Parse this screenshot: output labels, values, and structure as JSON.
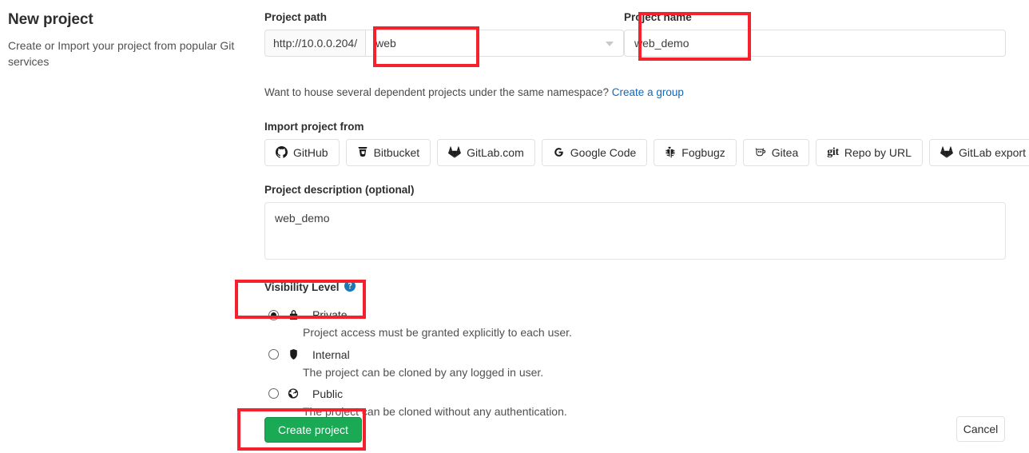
{
  "intro": {
    "title": "New project",
    "description": "Create or Import your project from popular Git services"
  },
  "form": {
    "project_path": {
      "label": "Project path",
      "prefix": "http://10.0.0.204/",
      "namespace_value": "web",
      "caret_icon": "chevron-down-icon"
    },
    "project_name": {
      "label": "Project name",
      "value": "web_demo",
      "placeholder": ""
    },
    "namespace_hint": {
      "text": "Want to house several dependent projects under the same namespace?",
      "link_label": "Create a group",
      "link_color": "#1068bf"
    },
    "import": {
      "label": "Import project from",
      "buttons": [
        {
          "label": "GitHub",
          "icon": "github-icon"
        },
        {
          "label": "Bitbucket",
          "icon": "bitbucket-icon"
        },
        {
          "label": "GitLab.com",
          "icon": "gitlab-icon"
        },
        {
          "label": "Google Code",
          "icon": "google-icon"
        },
        {
          "label": "Fogbugz",
          "icon": "bug-icon"
        },
        {
          "label": "Gitea",
          "icon": "gitea-icon"
        },
        {
          "label": "Repo by URL",
          "icon": "git-icon"
        },
        {
          "label": "GitLab export",
          "icon": "gitlab-icon"
        }
      ]
    },
    "description_field": {
      "label": "Project description (optional)",
      "value": "web_demo",
      "placeholder": ""
    },
    "visibility": {
      "label": "Visibility Level",
      "help_icon": "question-circle-icon",
      "options": [
        {
          "name": "Private",
          "icon": "lock-icon",
          "description": "Project access must be granted explicitly to each user.",
          "selected": true
        },
        {
          "name": "Internal",
          "icon": "shield-icon",
          "description": "The project can be cloned by any logged in user.",
          "selected": false
        },
        {
          "name": "Public",
          "icon": "globe-icon",
          "description": "The project can be cloned without any authentication.",
          "selected": false
        }
      ]
    }
  },
  "actions": {
    "create_label": "Create project",
    "cancel_label": "Cancel",
    "create_color": "#1aaa55"
  },
  "annotations": {
    "color": "#f5222d",
    "boxes": [
      "project-path-namespace",
      "project-name",
      "visibility-private",
      "create-project-button"
    ]
  }
}
